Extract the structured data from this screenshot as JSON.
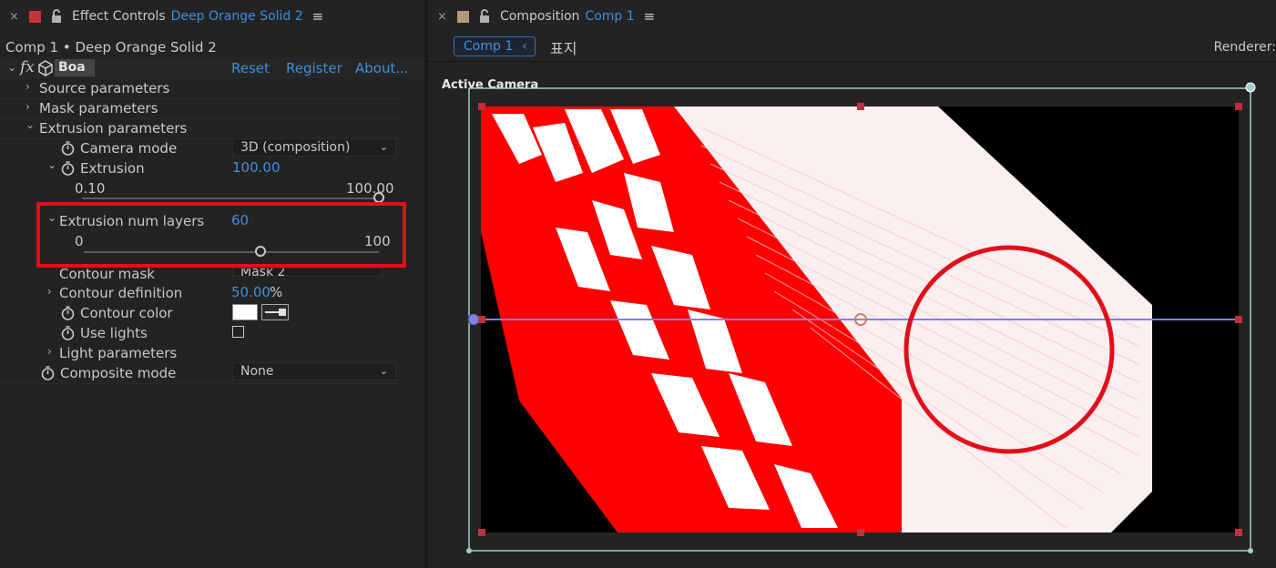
{
  "effect_controls": {
    "tab_close": "×",
    "swatch_color": "#c8323a",
    "tab_title": "Effect Controls",
    "tab_layer": "Deep Orange Solid 2",
    "breadcrumb": "Comp 1 • Deep Orange Solid 2",
    "effect": {
      "fx_label": "fx",
      "name": "Boa",
      "reset": "Reset",
      "register": "Register",
      "about": "About..."
    },
    "groups": {
      "source": "Source parameters",
      "mask": "Mask parameters",
      "extrusion": "Extrusion parameters",
      "light": "Light parameters"
    },
    "camera_mode": {
      "label": "Camera mode",
      "value": "3D (composition)"
    },
    "extrusion": {
      "label": "Extrusion",
      "value": "100.00",
      "min": "0.10",
      "max": "100.00"
    },
    "num_layers": {
      "label": "Extrusion num layers",
      "value": "60",
      "min": "0",
      "max": "100",
      "fraction": 0.6
    },
    "contour_mask": {
      "label": "Contour mask",
      "value": "Mask 2"
    },
    "contour_definition": {
      "label": "Contour definition",
      "value": "50.00",
      "unit": "%"
    },
    "contour_color": {
      "label": "Contour color",
      "color": "#ffffff"
    },
    "use_lights": {
      "label": "Use lights",
      "checked": false
    },
    "composite_mode": {
      "label": "Composite mode",
      "value": "None"
    }
  },
  "composition": {
    "tab_close": "×",
    "swatch_color": "#b09a7a",
    "tab_title": "Composition",
    "tab_comp": "Comp 1",
    "comp_tab_label": "Comp 1",
    "comp_tab_back": "‹",
    "korean_label": "표지",
    "renderer": "Renderer:",
    "view_label": "Active Camera",
    "accent_red": "#ff0000",
    "circle_color": "#e0101a",
    "bounds_color": "#9fd0c8"
  }
}
